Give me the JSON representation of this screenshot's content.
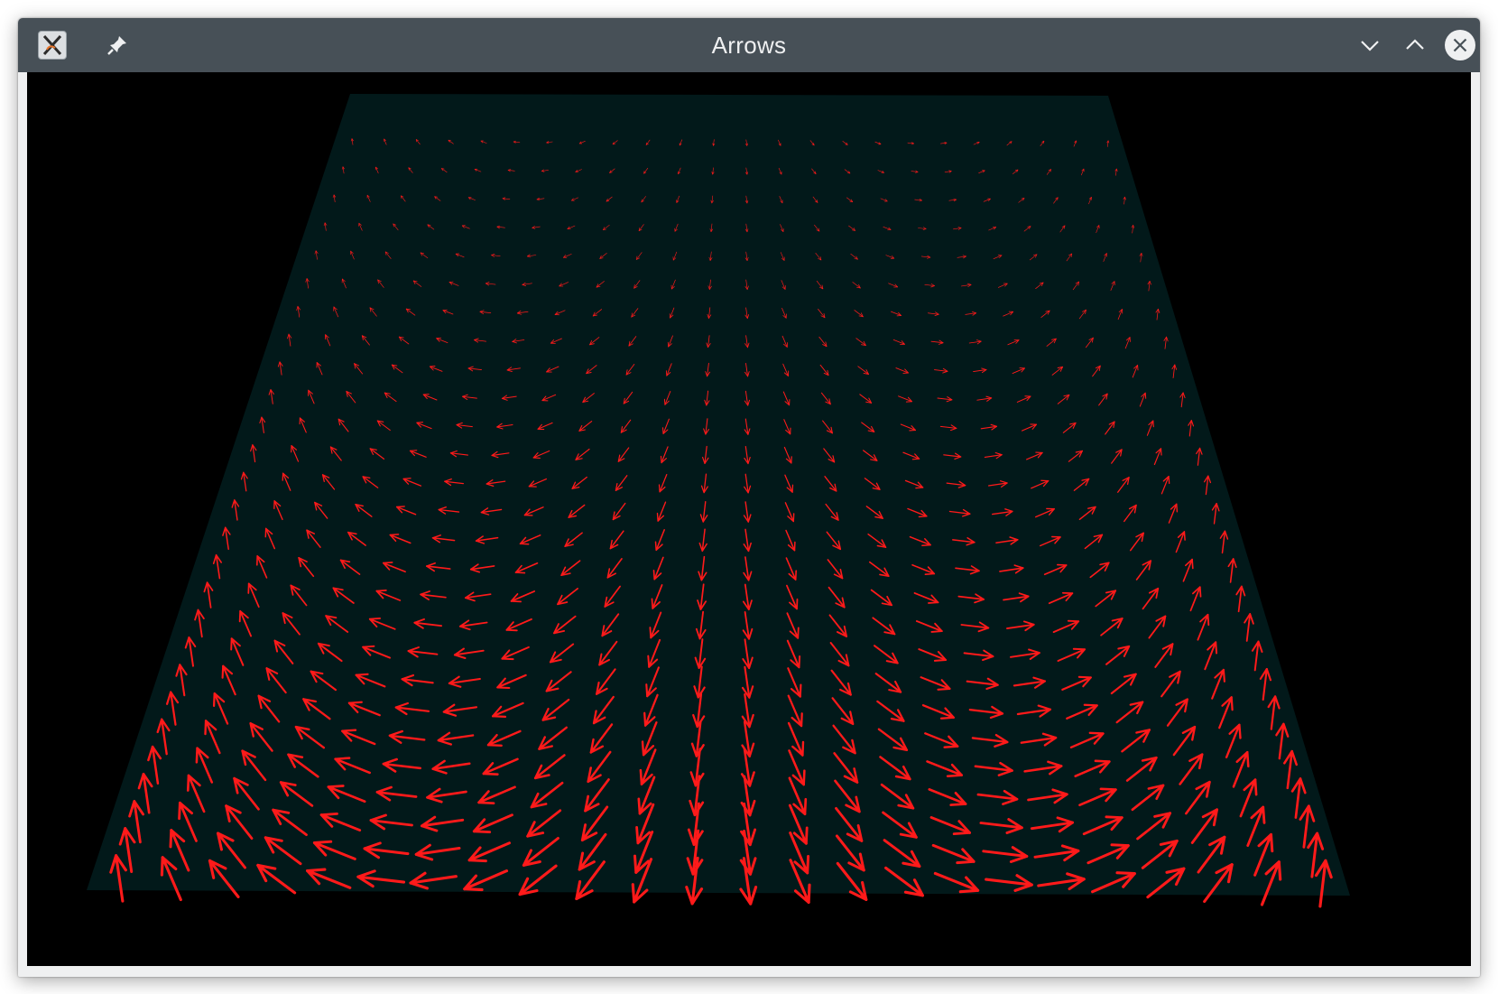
{
  "window": {
    "title": "Arrows",
    "app_icon": "x-app-icon",
    "pin_icon": "pin-icon",
    "minimize_icon": "chevron-down-icon",
    "maximize_icon": "chevron-up-icon",
    "close_icon": "close-icon"
  },
  "scene": {
    "background_color": "#000000",
    "plane_color": "#02191a",
    "arrow_color": "#ff1a1a",
    "field_description_hidden": "",
    "grid_columns": 24,
    "grid_rows": 27
  }
}
